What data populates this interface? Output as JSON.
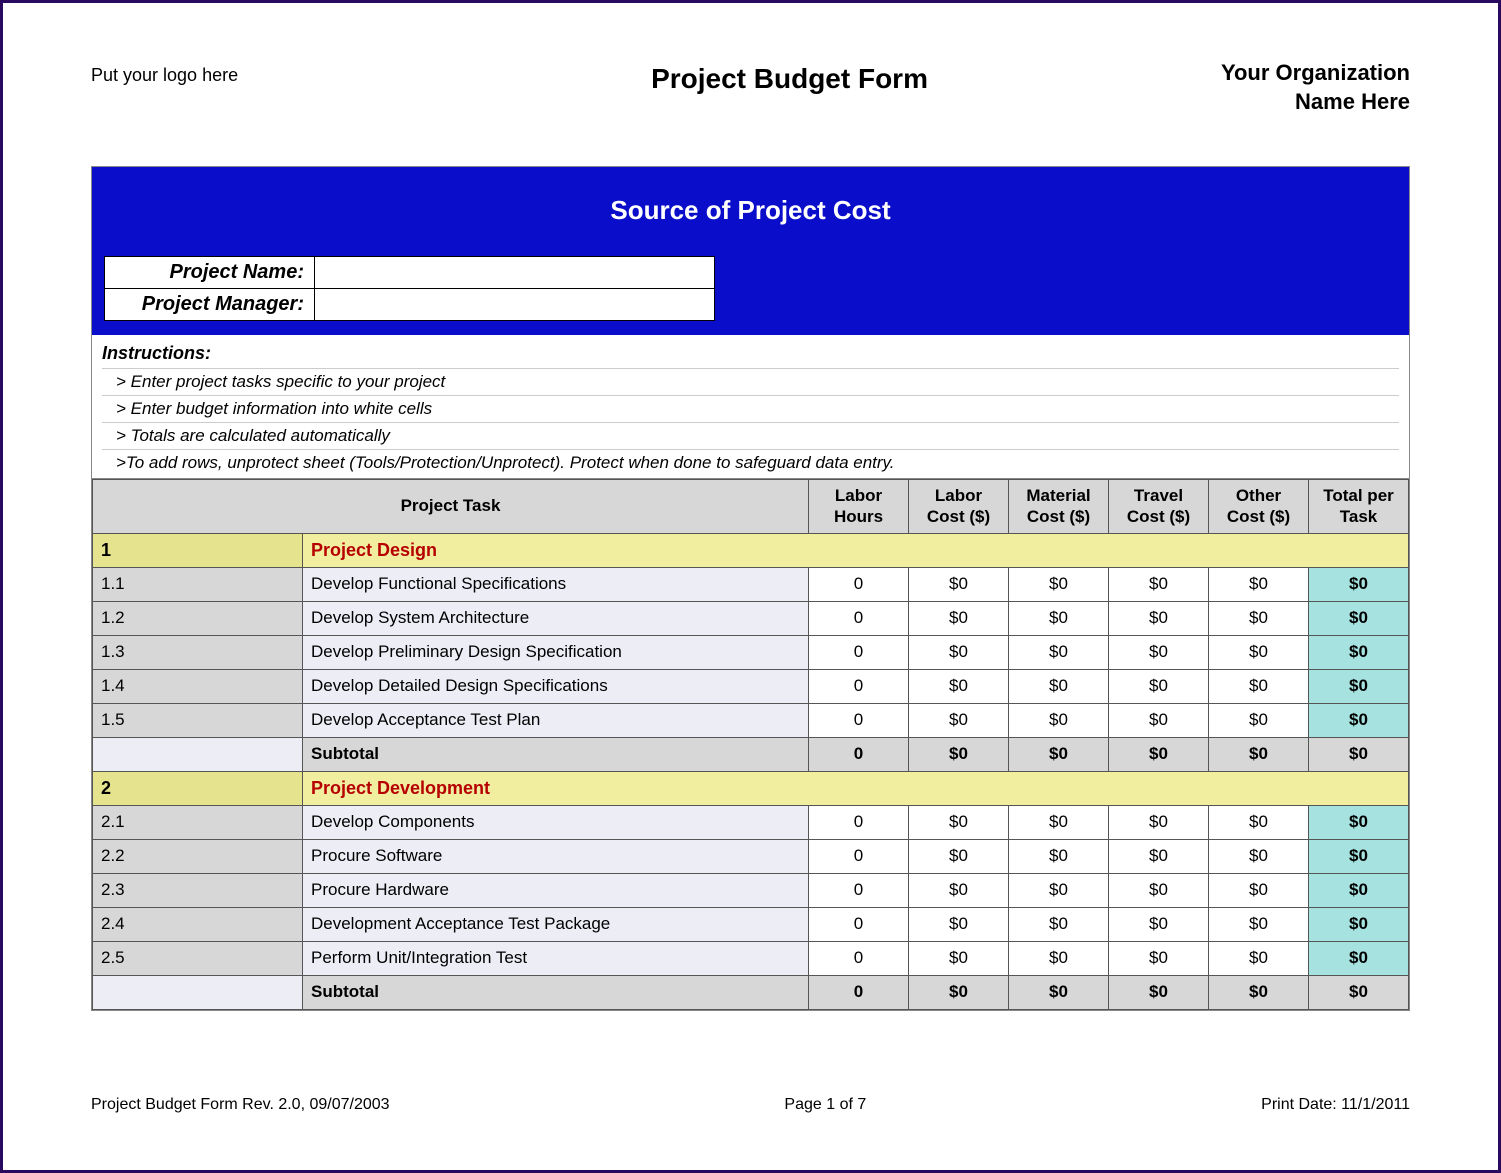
{
  "header": {
    "logo_text": "Put your logo here",
    "title": "Project Budget Form",
    "org_line1": "Your Organization",
    "org_line2": "Name Here"
  },
  "blue": {
    "title": "Source of Project Cost",
    "project_name_label": "Project Name:",
    "project_manager_label": "Project Manager:",
    "project_name_value": "",
    "project_manager_value": ""
  },
  "instructions": {
    "heading": "Instructions:",
    "lines": [
      "> Enter project tasks specific to your project",
      "> Enter budget information into white cells",
      "> Totals are calculated automatically",
      ">To add rows, unprotect sheet (Tools/Protection/Unprotect).  Protect when done to safeguard data entry."
    ]
  },
  "columns": {
    "task": "Project Task",
    "labor_hours": "Labor Hours",
    "labor_cost": "Labor Cost ($)",
    "material_cost": "Material Cost ($)",
    "travel_cost": "Travel Cost ($)",
    "other_cost": "Other Cost ($)",
    "total": "Total per Task"
  },
  "sections": [
    {
      "num": "1",
      "title": "Project Design",
      "rows": [
        {
          "num": "1.1",
          "task": "Develop Functional Specifications",
          "hours": "0",
          "labor": "$0",
          "material": "$0",
          "travel": "$0",
          "other": "$0",
          "total": "$0"
        },
        {
          "num": "1.2",
          "task": "Develop System Architecture",
          "hours": "0",
          "labor": "$0",
          "material": "$0",
          "travel": "$0",
          "other": "$0",
          "total": "$0"
        },
        {
          "num": "1.3",
          "task": "Develop Preliminary Design Specification",
          "hours": "0",
          "labor": "$0",
          "material": "$0",
          "travel": "$0",
          "other": "$0",
          "total": "$0"
        },
        {
          "num": "1.4",
          "task": "Develop Detailed Design Specifications",
          "hours": "0",
          "labor": "$0",
          "material": "$0",
          "travel": "$0",
          "other": "$0",
          "total": "$0"
        },
        {
          "num": "1.5",
          "task": "Develop Acceptance Test Plan",
          "hours": "0",
          "labor": "$0",
          "material": "$0",
          "travel": "$0",
          "other": "$0",
          "total": "$0"
        }
      ],
      "subtotal": {
        "label": "Subtotal",
        "hours": "0",
        "labor": "$0",
        "material": "$0",
        "travel": "$0",
        "other": "$0",
        "total": "$0"
      }
    },
    {
      "num": "2",
      "title": "Project Development",
      "rows": [
        {
          "num": "2.1",
          "task": "Develop Components",
          "hours": "0",
          "labor": "$0",
          "material": "$0",
          "travel": "$0",
          "other": "$0",
          "total": "$0"
        },
        {
          "num": "2.2",
          "task": "Procure Software",
          "hours": "0",
          "labor": "$0",
          "material": "$0",
          "travel": "$0",
          "other": "$0",
          "total": "$0"
        },
        {
          "num": "2.3",
          "task": "Procure Hardware",
          "hours": "0",
          "labor": "$0",
          "material": "$0",
          "travel": "$0",
          "other": "$0",
          "total": "$0"
        },
        {
          "num": "2.4",
          "task": "Development Acceptance Test Package",
          "hours": "0",
          "labor": "$0",
          "material": "$0",
          "travel": "$0",
          "other": "$0",
          "total": "$0"
        },
        {
          "num": "2.5",
          "task": "Perform Unit/Integration Test",
          "hours": "0",
          "labor": "$0",
          "material": "$0",
          "travel": "$0",
          "other": "$0",
          "total": "$0"
        }
      ],
      "subtotal": {
        "label": "Subtotal",
        "hours": "0",
        "labor": "$0",
        "material": "$0",
        "travel": "$0",
        "other": "$0",
        "total": "$0"
      }
    }
  ],
  "footer": {
    "rev": "Project Budget Form Rev. 2.0, 09/07/2003",
    "page": "Page 1 of 7",
    "print_date": "Print Date: 11/1/2011"
  }
}
